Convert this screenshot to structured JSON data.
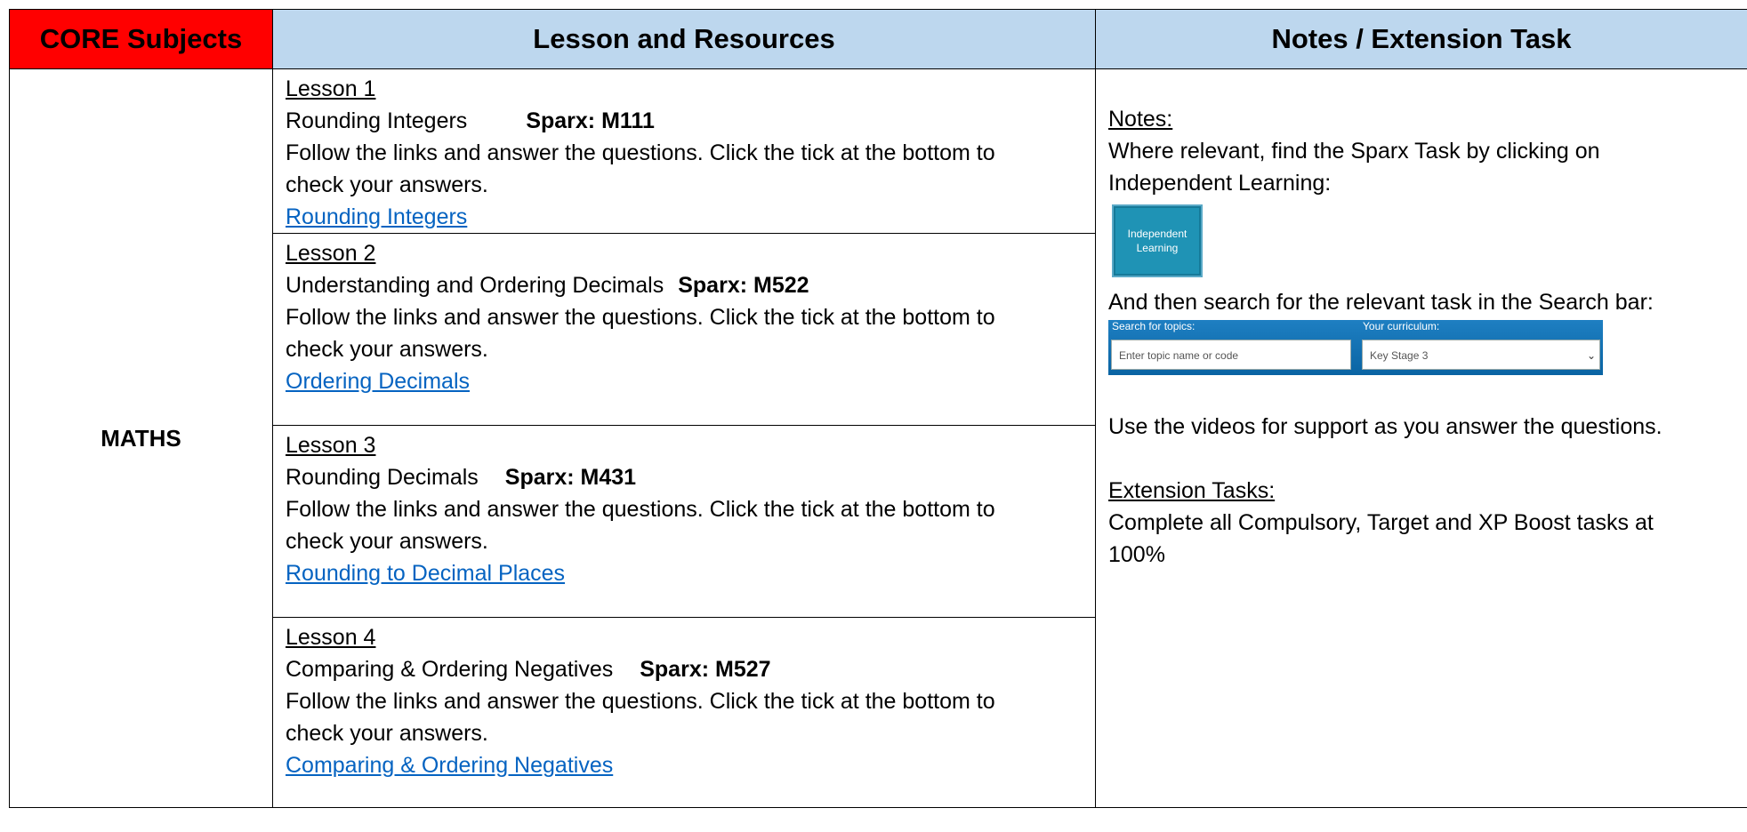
{
  "header": {
    "col1": "CORE Subjects",
    "col2": "Lesson and Resources",
    "col3": "Notes / Extension Task"
  },
  "subject": "MATHS",
  "lessons": [
    {
      "heading": "Lesson 1",
      "topic": "Rounding Integers",
      "sparx": "Sparx: M111",
      "instructions_line1": "Follow the links and answer the questions. Click the tick at the bottom to",
      "instructions_line2": "check your answers.",
      "link": "Rounding Integers"
    },
    {
      "heading": "Lesson 2",
      "topic": "Understanding and Ordering Decimals",
      "sparx": "Sparx: M522",
      "instructions_line1": "Follow the links and answer the questions. Click the tick at the bottom to",
      "instructions_line2": "check your answers.",
      "link": "Ordering Decimals"
    },
    {
      "heading": "Lesson 3",
      "topic": "Rounding Decimals",
      "sparx": "Sparx: M431",
      "instructions_line1": "Follow the links and answer the questions. Click the tick at the bottom to",
      "instructions_line2": "check your answers.",
      "link": "Rounding to Decimal Places"
    },
    {
      "heading": "Lesson 4",
      "topic": "Comparing & Ordering Negatives",
      "sparx": "Sparx: M527",
      "instructions_line1": "Follow the links and answer the questions. Click the tick at the bottom to",
      "instructions_line2": "check your answers.",
      "link": "Comparing & Ordering Negatives"
    }
  ],
  "notes": {
    "notes_heading": "Notes:",
    "notes_line1": "Where relevant, find the Sparx Task by clicking on",
    "notes_line2": "Independent Learning:",
    "independent_button_line1": "Independent",
    "independent_button_line2": "Learning",
    "search_intro": "And then search for the relevant task in the Search bar:",
    "search_topics_label": "Search for topics:",
    "search_topics_placeholder": "Enter topic name or code",
    "curriculum_label": "Your curriculum:",
    "curriculum_value": "Key Stage 3",
    "videos_text": "Use the videos for support as you answer the questions.",
    "extension_heading": "Extension Tasks:",
    "extension_line1": "Complete all Compulsory, Target and XP Boost tasks at",
    "extension_line2": "100%"
  },
  "colors": {
    "core_header_bg": "#ff0000",
    "header_bg": "#bdd7ee",
    "link": "#0563c1",
    "sparx_button": "#1f93b5"
  }
}
